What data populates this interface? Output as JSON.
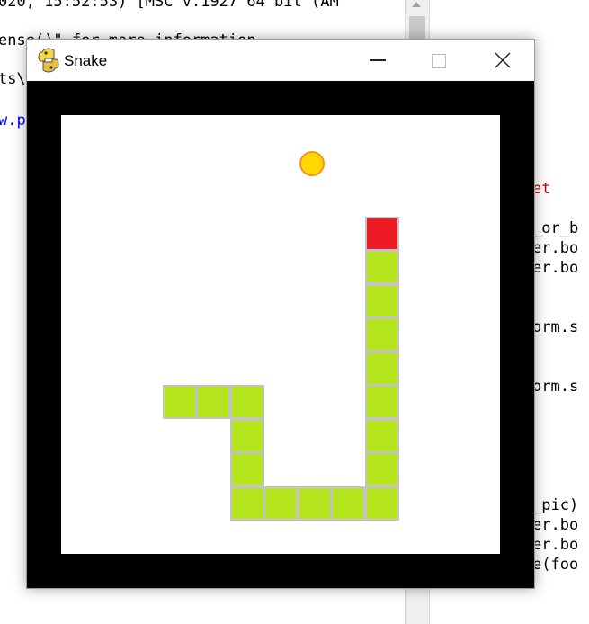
{
  "editor": {
    "lines": [
      {
        "text": "020, 15:52:53) [MSC v.1927 64 bit (AM",
        "color": "#000000"
      },
      {
        "text": "ense()\" for more information.",
        "color": "#000000"
      },
      {
        "text": "ts\\",
        "color": "#000000"
      },
      {
        "text": "w.p",
        "color": "#0000ff"
      },
      {
        "text": "et",
        "color": "#c00000"
      },
      {
        "text": "_or_b",
        "color": "#000000"
      },
      {
        "text": "er.bo",
        "color": "#000000"
      },
      {
        "text": "er.bo",
        "color": "#000000"
      },
      {
        "text": "orm.s",
        "color": "#000000"
      },
      {
        "text": "orm.s",
        "color": "#000000"
      },
      {
        "text": "_pic)",
        "color": "#000000"
      },
      {
        "text": "er.bo",
        "color": "#000000"
      },
      {
        "text": "er.bo",
        "color": "#000000"
      },
      {
        "text": "e(foo",
        "color": "#000000"
      }
    ]
  },
  "window": {
    "title": "Snake",
    "icon": "python-snake-icon"
  },
  "game": {
    "board_cells": 13,
    "colors": {
      "border": "#000000",
      "field": "#ffffff",
      "snake_body": "#b5e61d",
      "snake_head": "#ed1c24",
      "segment_outline": "#c3c3c3",
      "food_fill": "#ffd800",
      "food_outline": "#f7941d"
    },
    "snake": [
      {
        "col": 9,
        "row": 3,
        "part": "head"
      },
      {
        "col": 9,
        "row": 4,
        "part": "body"
      },
      {
        "col": 9,
        "row": 5,
        "part": "body"
      },
      {
        "col": 9,
        "row": 6,
        "part": "body"
      },
      {
        "col": 9,
        "row": 7,
        "part": "body"
      },
      {
        "col": 9,
        "row": 8,
        "part": "body"
      },
      {
        "col": 9,
        "row": 9,
        "part": "body"
      },
      {
        "col": 9,
        "row": 10,
        "part": "body"
      },
      {
        "col": 9,
        "row": 11,
        "part": "body"
      },
      {
        "col": 8,
        "row": 11,
        "part": "body"
      },
      {
        "col": 7,
        "row": 11,
        "part": "body"
      },
      {
        "col": 6,
        "row": 11,
        "part": "body"
      },
      {
        "col": 5,
        "row": 11,
        "part": "body"
      },
      {
        "col": 5,
        "row": 10,
        "part": "body"
      },
      {
        "col": 5,
        "row": 9,
        "part": "body"
      },
      {
        "col": 5,
        "row": 8,
        "part": "body"
      },
      {
        "col": 4,
        "row": 8,
        "part": "body"
      },
      {
        "col": 3,
        "row": 8,
        "part": "body"
      }
    ]
  }
}
